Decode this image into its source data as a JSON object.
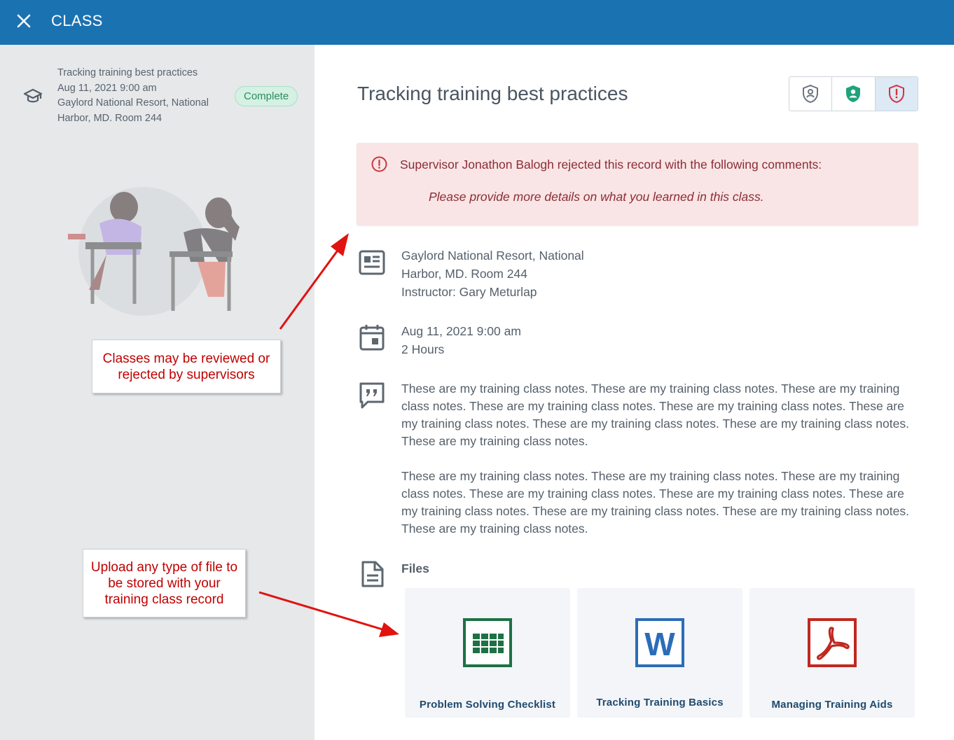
{
  "header": {
    "title": "CLASS",
    "close_icon": "close-icon"
  },
  "sidebar": {
    "class_item": {
      "icon": "graduation-cap-icon",
      "lines": [
        "Tracking training best practices",
        "Aug 11, 2021 9:00 am",
        "Gaylord National Resort, National",
        "Harbor, MD. Room 244"
      ],
      "status": "Complete"
    }
  },
  "callouts": {
    "review": [
      "Classes may be reviewed or",
      "rejected by supervisors"
    ],
    "upload": [
      "Upload any type of file to",
      "be stored with your",
      "training class record"
    ]
  },
  "main": {
    "title": "Tracking training best practices",
    "status_buttons": [
      {
        "icon": "shield-person-outline-icon"
      },
      {
        "icon": "shield-person-approved-icon"
      },
      {
        "icon": "shield-exclamation-rejected-icon"
      }
    ],
    "rejection": {
      "icon": "alert-circle-icon",
      "message": "Supervisor Jonathon Balogh rejected this record with the following comments:",
      "comment": "Please provide more details on what you learned in this class."
    },
    "location": {
      "icon": "location-card-icon",
      "lines": [
        "Gaylord National Resort, National",
        "Harbor, MD. Room 244",
        "Instructor: Gary Meturlap"
      ]
    },
    "schedule": {
      "icon": "calendar-icon",
      "lines": [
        "Aug 11, 2021 9:00 am",
        "2 Hours"
      ]
    },
    "notes": {
      "icon": "quote-comment-icon",
      "paragraphs": [
        "These are my training class notes. These are my training class notes. These are my training class notes. These are my training class notes. These are my training class notes. These are my training class notes. These are my training class notes. These are my training class notes. These are my training class notes.",
        "These are my training class notes. These are my training class notes. These are my training class notes. These are my training class notes. These are my training class notes. These are my training class notes. These are my training class notes. These are my training class notes. These are my training class notes."
      ]
    },
    "files": {
      "icon": "document-icon",
      "label": "Files",
      "items": [
        {
          "name": "Problem Solving Checklist",
          "icon": "spreadsheet-file-icon",
          "color": "#1e7145"
        },
        {
          "name": "Tracking Training Basics",
          "icon": "word-file-icon",
          "color": "#2b6cb8"
        },
        {
          "name": "Managing Training Aids",
          "icon": "pdf-file-icon",
          "color": "#c0281f"
        }
      ]
    }
  },
  "colors": {
    "topbar": "#1b72b1",
    "complete_badge": "#2d8a60",
    "reject_bg": "#f9e5e6",
    "reject_text": "#8b2d36",
    "callout_text": "#c00000"
  }
}
